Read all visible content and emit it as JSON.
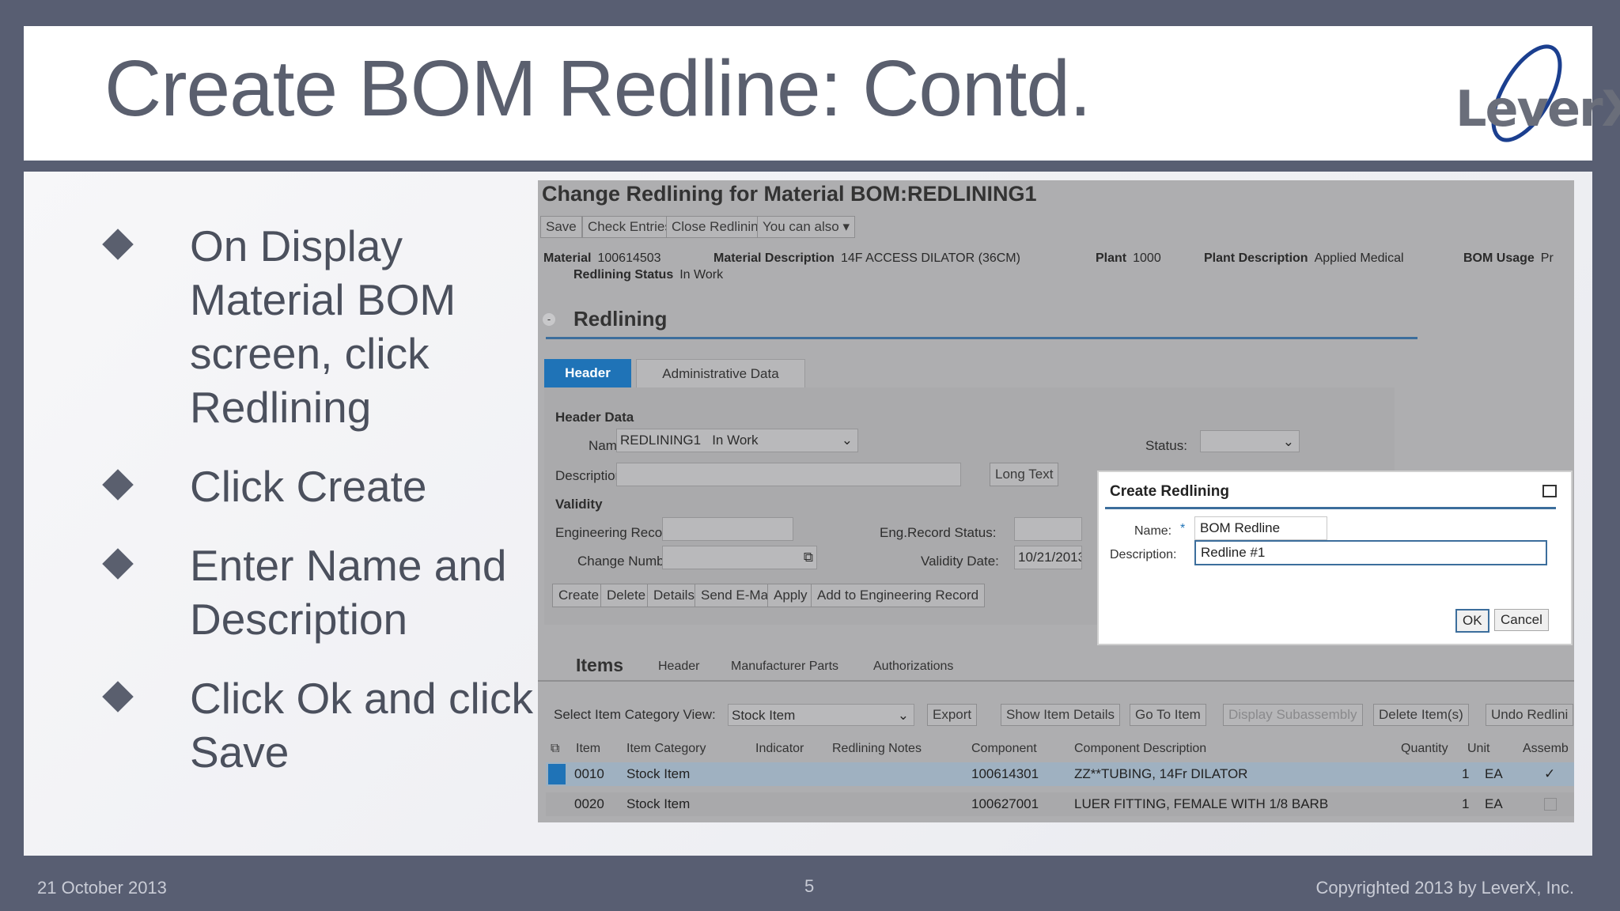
{
  "slide": {
    "title": "Create BOM Redline: Contd.",
    "logo": "LeverX",
    "bullets": [
      "On Display Material BOM screen, click Redlining",
      "Click Create",
      "Enter Name and Description",
      "Click Ok and click Save"
    ],
    "footer": {
      "date": "21 October 2013",
      "page": "5",
      "copyright": "Copyrighted 2013 by LeverX, Inc."
    }
  },
  "sap": {
    "title": "Change Redlining for Material BOM:REDLINING1",
    "toolbar": [
      "Save",
      "Check Entries",
      "Close Redlining",
      "You can also"
    ],
    "meta": {
      "material_label": "Material",
      "material_value": "100614503",
      "matdesc_label": "Material Description",
      "matdesc_value": "14F ACCESS DILATOR (36CM)",
      "plant_label": "Plant",
      "plant_value": "1000",
      "plantdesc_label": "Plant Description",
      "plantdesc_value": "Applied Medical",
      "bomusage_label": "BOM Usage",
      "bomusage_value": "Pr",
      "status_label": "Redlining Status",
      "status_value": "In Work"
    },
    "section_title": "Redlining",
    "tabs": [
      "Header",
      "Administrative Data"
    ],
    "header_data": {
      "heading": "Header Data",
      "name_label": "Name:",
      "name_value": "REDLINING1",
      "name_status": "In Work",
      "description_label": "Description:",
      "long_text_button": "Long Text",
      "status_label": "Status:",
      "validity_heading": "Validity",
      "eng_record_label": "Engineering Record:",
      "eng_status_label": "Eng.Record Status:",
      "change_number_label": "Change Number:",
      "validity_date_label": "Validity Date:",
      "validity_date_value": "10/21/2013"
    },
    "actions": [
      "Create",
      "Delete",
      "Details",
      "Send E-Mail",
      "Apply",
      "Add to Engineering Record"
    ],
    "dialog": {
      "title": "Create Redlining",
      "name_label": "Name:",
      "name_value": "BOM Redline",
      "description_label": "Description:",
      "description_value": "Redline #1",
      "ok": "OK",
      "cancel": "Cancel"
    },
    "items_tabs": [
      "Items",
      "Header",
      "Manufacturer Parts",
      "Authorizations"
    ],
    "items_toolbar": {
      "view_label": "Select Item Category View:",
      "view_value": "Stock Item",
      "buttons": [
        "Export",
        "Show Item Details",
        "Go To Item",
        "Display Subassembly",
        "Delete Item(s)",
        "Undo Redlini"
      ]
    },
    "table": {
      "headers": [
        "Item",
        "Item Category",
        "Indicator",
        "Redlining Notes",
        "Component",
        "Component Description",
        "Quantity",
        "Unit",
        "Assemb"
      ],
      "rows": [
        {
          "item": "0010",
          "category": "Stock Item",
          "component": "100614301",
          "description": "ZZ**TUBING, 14Fr DILATOR",
          "quantity": "1",
          "unit": "EA"
        },
        {
          "item": "0020",
          "category": "Stock Item",
          "component": "100627001",
          "description": "LUER FITTING, FEMALE WITH 1/8 BARB",
          "quantity": "1",
          "unit": "EA"
        }
      ]
    }
  }
}
